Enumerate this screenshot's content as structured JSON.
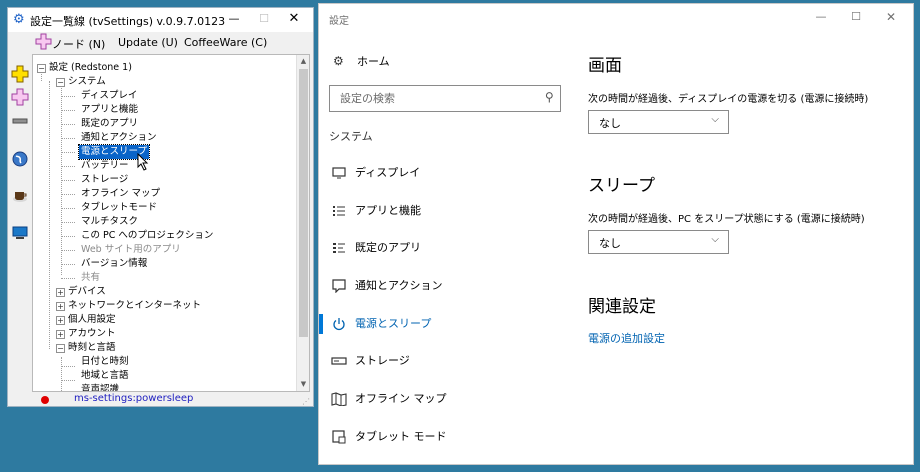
{
  "left_window": {
    "title": "設定一覧線 (tvSettings)  v.0.9.7.0123",
    "window_controls": {
      "minimize": "—",
      "maximize": "☐",
      "close": "✕"
    },
    "menu": {
      "node": "ノード (N)",
      "update": "Update (U)",
      "coffeeware": "CoffeeWare (C)"
    },
    "tree": {
      "root": "設定 (Redstone 1)",
      "system": "システム",
      "system_items": [
        "ディスプレイ",
        "アプリと機能",
        "既定のアプリ",
        "通知とアクション",
        "電源とスリープ",
        "バッテリー",
        "ストレージ",
        "オフライン マップ",
        "タブレットモード",
        "マルチタスク",
        "この PC へのプロジェクション",
        "Web サイト用のアプリ",
        "バージョン情報",
        "共有"
      ],
      "groups": [
        "デバイス",
        "ネットワークとインターネット",
        "個人用設定",
        "アカウント",
        "時刻と言語"
      ],
      "time_items": [
        "日付と時刻",
        "地域と言語",
        "音声認識"
      ]
    },
    "status": "ms-settings:powersleep",
    "sidebar_icons": [
      "add-node-icon",
      "add-child-icon",
      "remove-icon",
      "globe-icon",
      "coffee-icon",
      "computer-icon"
    ],
    "colors": {
      "selection": "#0a64c8",
      "status_dot": "#e00000",
      "status_text": "#2020c0"
    }
  },
  "right_window": {
    "title": "設定",
    "window_controls": {
      "minimize": "—",
      "maximize": "☐",
      "close": "✕"
    },
    "home": "ホーム",
    "search_placeholder": "設定の検索",
    "section": "システム",
    "nav": [
      {
        "label": "ディスプレイ",
        "icon": "monitor-icon"
      },
      {
        "label": "アプリと機能",
        "icon": "apps-list-icon"
      },
      {
        "label": "既定のアプリ",
        "icon": "default-apps-icon"
      },
      {
        "label": "通知とアクション",
        "icon": "notification-icon"
      },
      {
        "label": "電源とスリープ",
        "icon": "power-icon",
        "active": true
      },
      {
        "label": "ストレージ",
        "icon": "storage-icon"
      },
      {
        "label": "オフライン マップ",
        "icon": "map-icon"
      },
      {
        "label": "タブレット モード",
        "icon": "tablet-icon"
      }
    ],
    "screen": {
      "heading": "画面",
      "desc": "次の時間が経過後、ディスプレイの電源を切る (電源に接続時)",
      "value": "なし"
    },
    "sleep": {
      "heading": "スリープ",
      "desc": "次の時間が経過後、PC をスリープ状態にする (電源に接続時)",
      "value": "なし"
    },
    "related": {
      "heading": "関連設定",
      "link": "電源の追加設定"
    },
    "colors": {
      "accent": "#0078d7",
      "link": "#0063b1"
    }
  }
}
